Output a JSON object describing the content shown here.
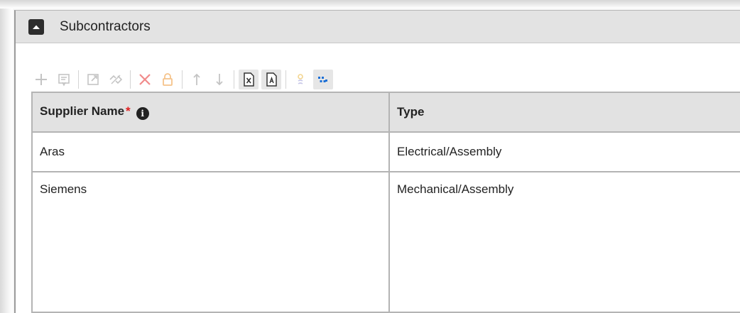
{
  "panel": {
    "title": "Subcontractors"
  },
  "toolbar": {
    "buttons": [
      {
        "icon": "plus-icon",
        "enabled": false
      },
      {
        "icon": "pick-list-icon",
        "enabled": false
      },
      {
        "icon": "open-icon",
        "enabled": false
      },
      {
        "icon": "unlink-icon",
        "enabled": false
      },
      {
        "icon": "delete-icon",
        "enabled": false
      },
      {
        "icon": "lock-icon",
        "enabled": false
      },
      {
        "icon": "move-up-icon",
        "enabled": false
      },
      {
        "icon": "move-down-icon",
        "enabled": false
      },
      {
        "icon": "export-excel-icon",
        "enabled": true
      },
      {
        "icon": "export-pdf-icon",
        "enabled": true
      },
      {
        "icon": "search-mode-icon",
        "enabled": false
      },
      {
        "icon": "grid-view-icon",
        "enabled": true
      }
    ]
  },
  "grid": {
    "columns": [
      {
        "label": "Supplier Name",
        "required": true,
        "required_mark": "*",
        "info": "i"
      },
      {
        "label": "Type"
      }
    ],
    "rows": [
      {
        "supplier": "Aras",
        "type": "Electrical/Assembly"
      },
      {
        "supplier": "Siemens",
        "type": "Mechanical/Assembly"
      }
    ]
  },
  "colors": {
    "header_bg": "#e3e3e3",
    "grid_header_bg": "#e2e2e2",
    "border": "#b4b4b4",
    "delete_red": "#f08a8a",
    "lock_orange": "#f5c38a",
    "grid_view_blue": "#1a6fd6",
    "required_red": "#e02020"
  }
}
